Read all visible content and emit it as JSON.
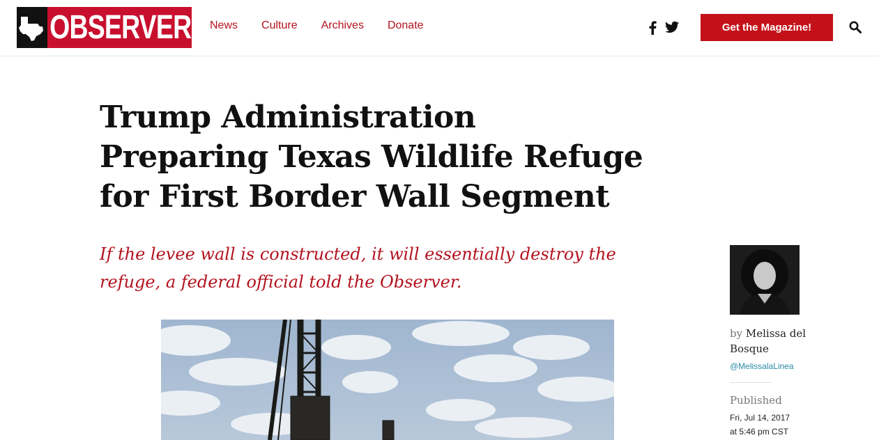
{
  "header": {
    "logo_text": "OBSERVER",
    "nav": [
      "News",
      "Culture",
      "Archives",
      "Donate"
    ],
    "cta_label": "Get the Magazine!",
    "icons": {
      "logo_mark": "texas-map-icon",
      "facebook": "facebook-icon",
      "twitter": "twitter-icon",
      "search": "search-icon"
    }
  },
  "article": {
    "title_lines": [
      "Trump Administration",
      "Preparing Texas Wildlife Refuge",
      "for First Border Wall Segment"
    ],
    "dek_lines": [
      "If the levee wall is constructed, it will essentially destroy the",
      "refuge, a federal official told the Observer."
    ]
  },
  "sidebar": {
    "by": "by",
    "author": "Melissa del Bosque",
    "handle": "@MelissalaLinea",
    "published_label": "Published",
    "date": "Fri, Jul 14, 2017",
    "time": "at 5:46 pm CST"
  },
  "colors": {
    "brand_red": "#c8102e",
    "nav_red": "#b3121e",
    "cta_red": "#c41119",
    "handle_teal": "#2a8aa8"
  }
}
